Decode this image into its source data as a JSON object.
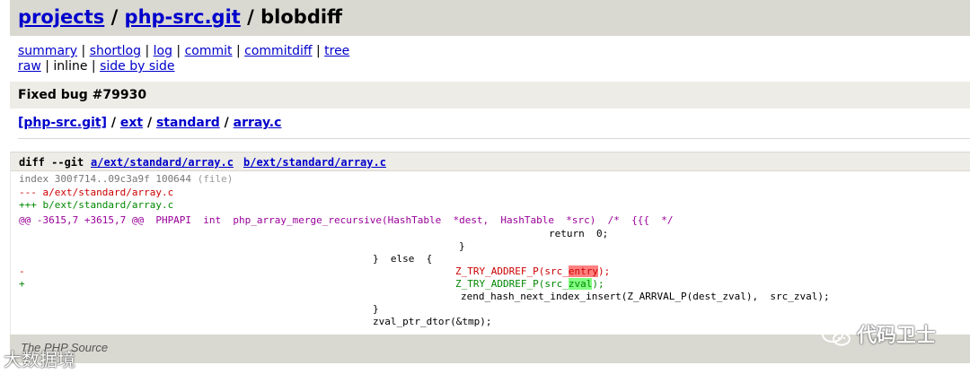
{
  "header": {
    "project": "projects",
    "repo": "php-src.git",
    "action": "blobdiff"
  },
  "nav": {
    "summary": "summary",
    "shortlog": "shortlog",
    "log": "log",
    "commit": "commit",
    "commitdiff": "commitdiff",
    "tree": "tree",
    "raw": "raw",
    "inline": "inline",
    "side_by_side": "side by side"
  },
  "subject": "Fixed bug #79930",
  "path": {
    "root": "[php-src.git]",
    "ext": "ext",
    "standard": "standard",
    "file": "array.c"
  },
  "diff": {
    "cmd": "diff --git",
    "a_file": "a/ext/standard/array.c",
    "b_file": "b/ext/standard/array.c",
    "index": "index 300f714..09c3a9f 100644",
    "index_file": "(file)",
    "minus_file": "--- a/ext/standard/array.c",
    "plus_file": "+++ b/ext/standard/array.c",
    "hunk": "@@ -3615,7 +3615,7 @@  PHPAPI  int  php_array_merge_recursive(HashTable  *dest,  HashTable  *src)  /*  {{{  */",
    "lines": {
      "return0": "return  0;",
      "brace1": "}",
      "else": "}  else  {",
      "minus_sign": "-",
      "minus_pre": "Z_TRY_ADDREF_P(src_",
      "minus_hl": "entry",
      "minus_post": ");",
      "plus_sign": "+",
      "plus_pre": "Z_TRY_ADDREF_P(src_",
      "plus_hl": "zval",
      "plus_post": ");",
      "insert": "zend_hash_next_index_insert(Z_ARRVAL_P(dest_zval),  src_zval);",
      "brace2": "}",
      "dtor": "zval_ptr_dtor(&tmp);"
    }
  },
  "footer": "The PHP Source",
  "watermarks": {
    "right": "代码卫士",
    "left": "大数据境"
  }
}
